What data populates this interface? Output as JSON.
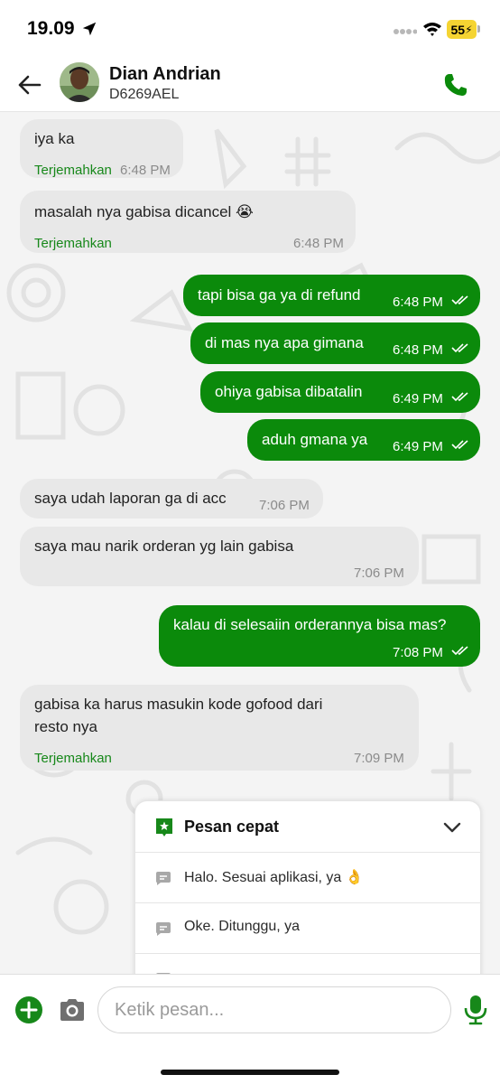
{
  "status_bar": {
    "time": "19.09",
    "battery": "55",
    "icons": [
      "location-arrow-icon",
      "signal-icon",
      "wifi-icon",
      "battery-charging-icon"
    ]
  },
  "header": {
    "contact_name": "Dian Andrian",
    "contact_id": "D6269AEL",
    "icons": [
      "back-arrow-icon",
      "phone-icon"
    ]
  },
  "messages": [
    {
      "direction": "in",
      "text": "iya ka",
      "translate_label": "Terjemahkan",
      "time": "6:48 PM"
    },
    {
      "direction": "in",
      "text": "masalah nya gabisa dicancel 😭",
      "translate_label": "Terjemahkan",
      "time": "6:48 PM"
    },
    {
      "direction": "out",
      "text": "tapi bisa ga ya di refund",
      "time": "6:48 PM",
      "status": "read"
    },
    {
      "direction": "out",
      "text": "di mas nya apa gimana",
      "time": "6:48 PM",
      "status": "read"
    },
    {
      "direction": "out",
      "text": "ohiya gabisa dibatalin",
      "time": "6:49 PM",
      "status": "read"
    },
    {
      "direction": "out",
      "text": "aduh gmana ya",
      "time": "6:49 PM",
      "status": "read"
    },
    {
      "direction": "in",
      "text": "saya udah laporan ga di acc",
      "time": "7:06 PM"
    },
    {
      "direction": "in",
      "text": "saya mau narik orderan yg lain gabisa",
      "time": "7:06 PM"
    },
    {
      "direction": "out",
      "text": "kalau di selesaiin orderannya bisa mas?",
      "time": "7:08 PM",
      "status": "read"
    },
    {
      "direction": "in",
      "text_line1": "gabisa ka harus masukin kode gofood dari",
      "text_line2": "resto nya",
      "translate_label": "Terjemahkan",
      "time": "7:09 PM"
    }
  ],
  "quick_messages": {
    "title": "Pesan cepat",
    "items": [
      "Halo. Sesuai aplikasi, ya 👌",
      "Oke. Ditunggu, ya"
    ],
    "icons": [
      "star-badge-icon",
      "chevron-down-icon",
      "message-icon"
    ]
  },
  "input_bar": {
    "placeholder": "Ketik pesan...",
    "icons": [
      "add-icon",
      "camera-icon",
      "microphone-icon"
    ]
  },
  "colors": {
    "outgoing_bubble": "#0b8a0b",
    "incoming_bubble": "#e8e8e8",
    "accent_green": "#17881a",
    "battery": "#f5d432"
  }
}
